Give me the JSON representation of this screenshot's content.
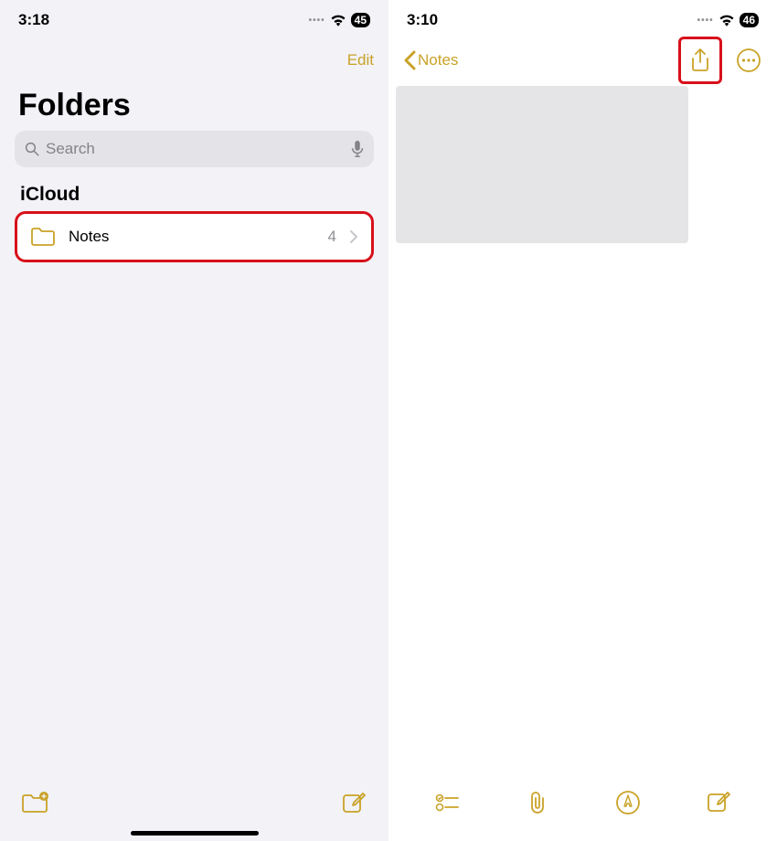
{
  "left": {
    "status": {
      "time": "3:18",
      "battery": "45"
    },
    "edit_label": "Edit",
    "title": "Folders",
    "search_placeholder": "Search",
    "section": "iCloud",
    "folder": {
      "name": "Notes",
      "count": "4"
    }
  },
  "right": {
    "status": {
      "time": "3:10",
      "battery": "46"
    },
    "back_label": "Notes"
  },
  "colors": {
    "accent": "#c9a227",
    "highlight": "#d8101a"
  }
}
